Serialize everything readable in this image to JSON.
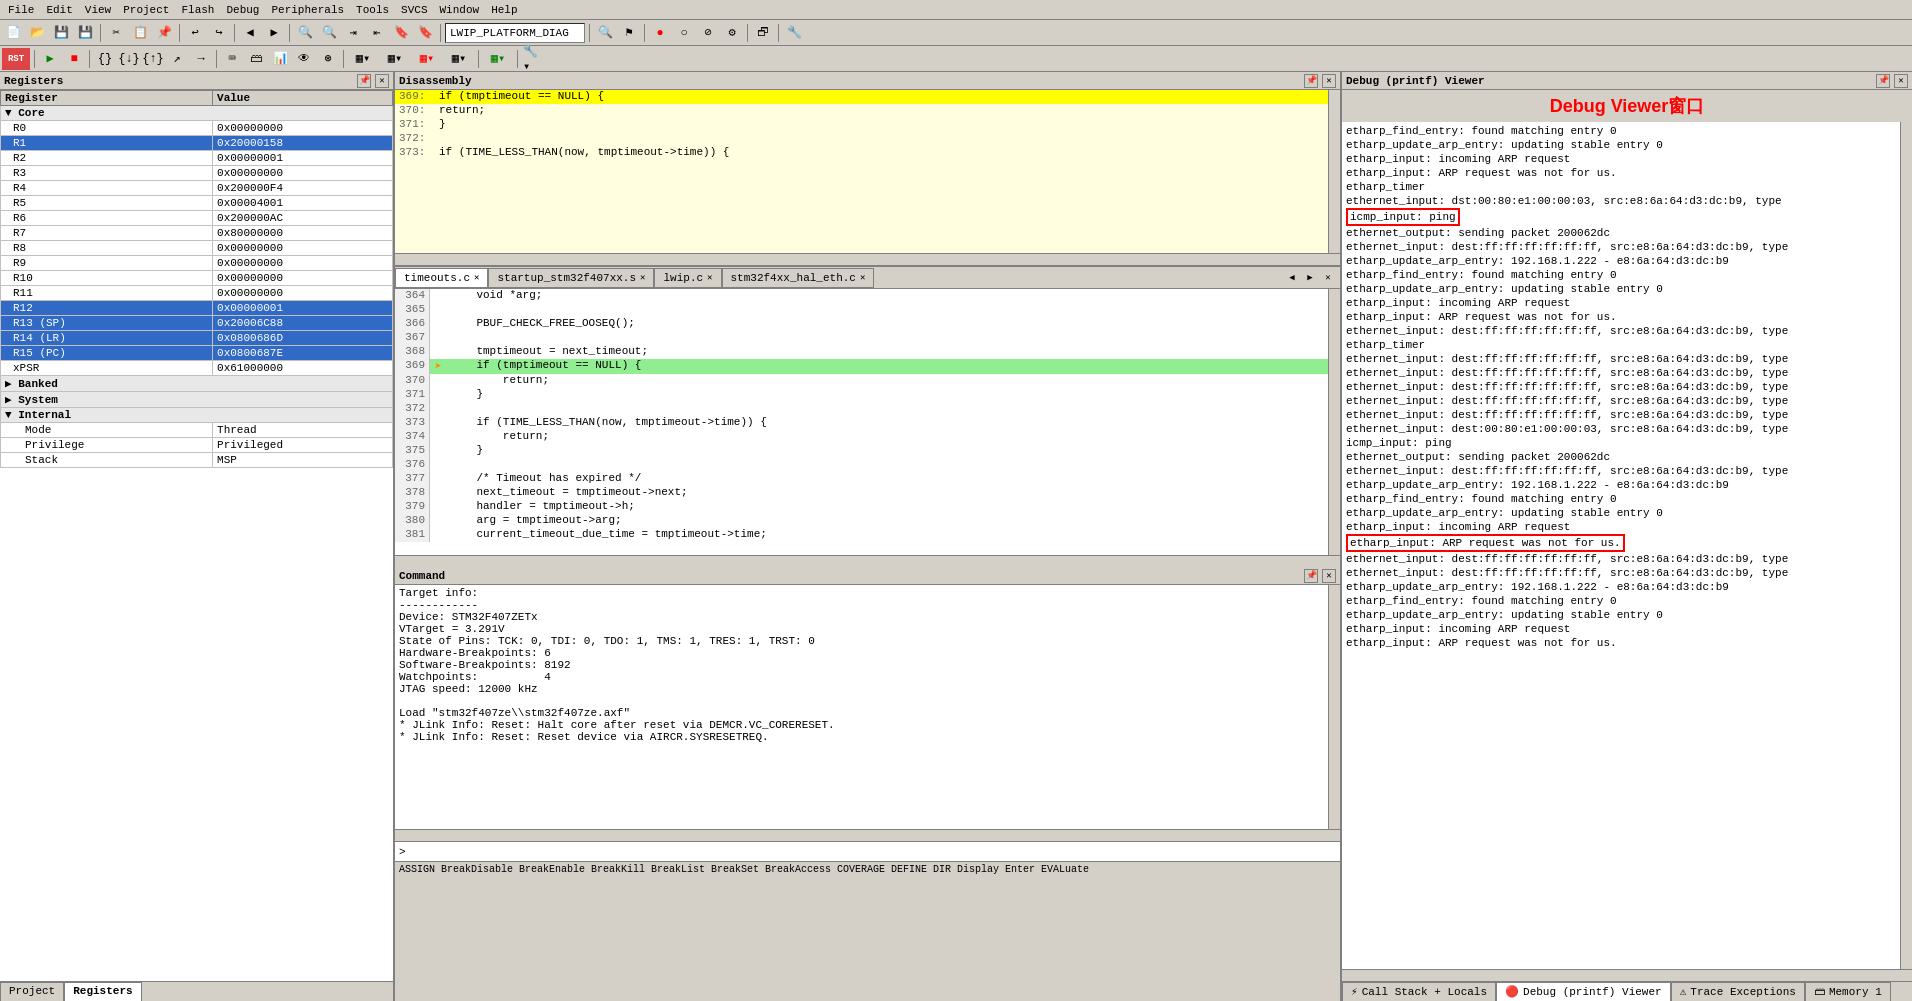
{
  "menubar": {
    "items": [
      "File",
      "Edit",
      "View",
      "Project",
      "Flash",
      "Debug",
      "Peripherals",
      "Tools",
      "SVCS",
      "Window",
      "Help"
    ]
  },
  "toolbar": {
    "target_label": "LWIP_PLATFORM_DIAG"
  },
  "registers": {
    "title": "Registers",
    "columns": [
      "Register",
      "Value"
    ],
    "groups": [
      {
        "name": "Core",
        "expanded": true,
        "registers": [
          {
            "name": "R0",
            "value": "0x00000000",
            "selected": false,
            "indent": 1
          },
          {
            "name": "R1",
            "value": "0x20000158",
            "selected": true,
            "indent": 1
          },
          {
            "name": "R2",
            "value": "0x00000001",
            "selected": false,
            "indent": 1
          },
          {
            "name": "R3",
            "value": "0x00000000",
            "selected": false,
            "indent": 1
          },
          {
            "name": "R4",
            "value": "0x200000F4",
            "selected": false,
            "indent": 1
          },
          {
            "name": "R5",
            "value": "0x00004001",
            "selected": false,
            "indent": 1
          },
          {
            "name": "R6",
            "value": "0x200000AC",
            "selected": false,
            "indent": 1
          },
          {
            "name": "R7",
            "value": "0x80000000",
            "selected": false,
            "indent": 1
          },
          {
            "name": "R8",
            "value": "0x00000000",
            "selected": false,
            "indent": 1
          },
          {
            "name": "R9",
            "value": "0x00000000",
            "selected": false,
            "indent": 1
          },
          {
            "name": "R10",
            "value": "0x00000000",
            "selected": false,
            "indent": 1
          },
          {
            "name": "R11",
            "value": "0x00000000",
            "selected": false,
            "indent": 1
          },
          {
            "name": "R12",
            "value": "0x00000001",
            "selected": true,
            "indent": 1
          },
          {
            "name": "R13 (SP)",
            "value": "0x20006C88",
            "selected": true,
            "indent": 1
          },
          {
            "name": "R14 (LR)",
            "value": "0x0800686D",
            "selected": true,
            "indent": 1
          },
          {
            "name": "R15 (PC)",
            "value": "0x0800687E",
            "selected": true,
            "indent": 1
          },
          {
            "name": "xPSR",
            "value": "0x61000000",
            "selected": false,
            "indent": 1
          }
        ]
      },
      {
        "name": "Banked",
        "expanded": false,
        "registers": []
      },
      {
        "name": "System",
        "expanded": false,
        "registers": []
      },
      {
        "name": "Internal",
        "expanded": true,
        "registers": [
          {
            "name": "Mode",
            "value": "Thread",
            "selected": false,
            "indent": 2
          },
          {
            "name": "Privilege",
            "value": "Privileged",
            "selected": false,
            "indent": 2
          },
          {
            "name": "Stack",
            "value": "MSP",
            "selected": false,
            "indent": 2
          }
        ]
      }
    ],
    "tabs": [
      "Project",
      "Registers"
    ],
    "active_tab": "Registers"
  },
  "disassembly": {
    "title": "Disassembly",
    "lines": [
      {
        "num": "369:",
        "code": "    if (tmptimeout == NULL) {",
        "highlight": true
      },
      {
        "num": "370:",
        "code": "        return;"
      },
      {
        "num": "371:",
        "code": "    }"
      },
      {
        "num": "372:",
        "code": ""
      },
      {
        "num": "373:",
        "code": "    if (TIME_LESS_THAN(now, tmptimeout->time)) {"
      }
    ]
  },
  "source_tabs": [
    {
      "name": "timeouts.c",
      "active": true,
      "modified": false
    },
    {
      "name": "startup_stm32f407xx.s",
      "active": false
    },
    {
      "name": "lwip.c",
      "active": false
    },
    {
      "name": "stm32f4xx_hal_eth.c",
      "active": false
    }
  ],
  "source": {
    "lines": [
      {
        "num": 364,
        "code": "    void *arg;",
        "marker": "",
        "current": false
      },
      {
        "num": 365,
        "code": "",
        "marker": "",
        "current": false
      },
      {
        "num": 366,
        "code": "    PBUF_CHECK_FREE_OOSEQ();",
        "marker": "",
        "current": false
      },
      {
        "num": 367,
        "code": "",
        "marker": "",
        "current": false
      },
      {
        "num": 368,
        "code": "    tmptimeout = next_timeout;",
        "marker": "",
        "current": false
      },
      {
        "num": 369,
        "code": "    if (tmptimeout == NULL) {",
        "marker": "arrow",
        "current": true
      },
      {
        "num": 370,
        "code": "        return;",
        "marker": "",
        "current": false
      },
      {
        "num": 371,
        "code": "    }",
        "marker": "",
        "current": false
      },
      {
        "num": 372,
        "code": "",
        "marker": "",
        "current": false
      },
      {
        "num": 373,
        "code": "    if (TIME_LESS_THAN(now, tmptimeout->time)) {",
        "marker": "",
        "current": false
      },
      {
        "num": 374,
        "code": "        return;",
        "marker": "",
        "current": false
      },
      {
        "num": 375,
        "code": "    }",
        "marker": "",
        "current": false
      },
      {
        "num": 376,
        "code": "",
        "marker": "",
        "current": false
      },
      {
        "num": 377,
        "code": "    /* Timeout has expired */",
        "marker": "",
        "current": false
      },
      {
        "num": 378,
        "code": "    next_timeout = tmptimeout->next;",
        "marker": "",
        "current": false
      },
      {
        "num": 379,
        "code": "    handler = tmptimeout->h;",
        "marker": "",
        "current": false
      },
      {
        "num": 380,
        "code": "    arg = tmptimeout->arg;",
        "marker": "",
        "current": false
      },
      {
        "num": 381,
        "code": "    current_timeout_due_time = tmptimeout->time;",
        "marker": "",
        "current": false
      }
    ]
  },
  "command": {
    "title": "Command",
    "content": "Target info:\n------------\nDevice: STM32F407ZETx\nVTarget = 3.291V\nState of Pins: TCK: 0, TDI: 0, TDO: 1, TMS: 1, TRES: 1, TRST: 0\nHardware-Breakpoints: 6\nSoftware-Breakpoints: 8192\nWatchpoints:          4\nJTAG speed: 12000 kHz\n\nLoad \"stm32f407ze\\\\stm32f407ze.axf\"\n* JLink Info: Reset: Halt core after reset via DEMCR.VC_CORERESET.\n* JLink Info: Reset: Reset device via AIRCR.SYSRESETREQ.",
    "hint": "ASSIGN BreakDisable BreakEnable BreakKill BreakList BreakSet BreakAccess COVERAGE DEFINE DIR Display Enter EVALuate"
  },
  "debug_viewer": {
    "title": "Debug (printf) Viewer",
    "window_title": "Debug Viewer窗口",
    "lines": [
      "etharp_find_entry: found matching entry 0",
      "etharp_update_arp_entry: updating stable entry 0",
      "etharp_input: incoming ARP request",
      "etharp_input: ARP request was not for us.",
      "etharp_timer",
      "ethernet_input: dst:00:80:e1:00:00:03, src:e8:6a:64:d3:dc:b9, type",
      "icmp_input: ping",
      "ethernet_output: sending packet 200062dc",
      "ethernet_input: dest:ff:ff:ff:ff:ff:ff, src:e8:6a:64:d3:dc:b9, type",
      "etharp_update_arp_entry: 192.168.1.222 - e8:6a:64:d3:dc:b9",
      "etharp_find_entry: found matching entry 0",
      "etharp_update_arp_entry: updating stable entry 0",
      "etharp_input: incoming ARP request",
      "etharp_input: ARP request was not for us.",
      "ethernet_input: dest:ff:ff:ff:ff:ff:ff, src:e8:6a:64:d3:dc:b9, type",
      "etharp_timer",
      "ethernet_input: dest:ff:ff:ff:ff:ff:ff, src:e8:6a:64:d3:dc:b9, type",
      "ethernet_input: dest:ff:ff:ff:ff:ff:ff, src:e8:6a:64:d3:dc:b9, type",
      "ethernet_input: dest:ff:ff:ff:ff:ff:ff, src:e8:6a:64:d3:dc:b9, type",
      "ethernet_input: dest:ff:ff:ff:ff:ff:ff, src:e8:6a:64:d3:dc:b9, type",
      "ethernet_input: dest:ff:ff:ff:ff:ff:ff, src:e8:6a:64:d3:dc:b9, type",
      "ethernet_input: dest:00:80:e1:00:00:03, src:e8:6a:64:d3:dc:b9, type",
      "icmp_input: ping",
      "ethernet_output: sending packet 200062dc",
      "ethernet_input: dest:ff:ff:ff:ff:ff:ff, src:e8:6a:64:d3:dc:b9, type",
      "etharp_update_arp_entry: 192.168.1.222 - e8:6a:64:d3:dc:b9",
      "etharp_find_entry: found matching entry 0",
      "etharp_update_arp_entry: updating stable entry 0",
      "etharp_input: incoming ARP request",
      "etharp_input: ARP request was not for us.",
      "ethernet_input: dest:ff:ff:ff:ff:ff:ff, src:e8:6a:64:d3:dc:b9, type",
      "ethernet_input: dest:ff:ff:ff:ff:ff:ff, src:e8:6a:64:d3:dc:b9, type",
      "etharp_update_arp_entry: 192.168.1.222 - e8:6a:64:d3:dc:b9",
      "etharp_find_entry: found matching entry 0",
      "etharp_update_arp_entry: updating stable entry 0",
      "etharp_input: incoming ARP request",
      "etharp_input: ARP request was not for us."
    ],
    "highlighted_lines": [
      6,
      22
    ],
    "boxed_lines": [
      6,
      29
    ],
    "bottom_tabs": [
      {
        "name": "Call Stack + Locals",
        "active": false,
        "icon": "stack"
      },
      {
        "name": "Debug (printf) Viewer",
        "active": true,
        "icon": "debug"
      },
      {
        "name": "Trace Exceptions",
        "active": false,
        "icon": "trace"
      },
      {
        "name": "Memory 1",
        "active": false,
        "icon": "memory"
      }
    ]
  }
}
